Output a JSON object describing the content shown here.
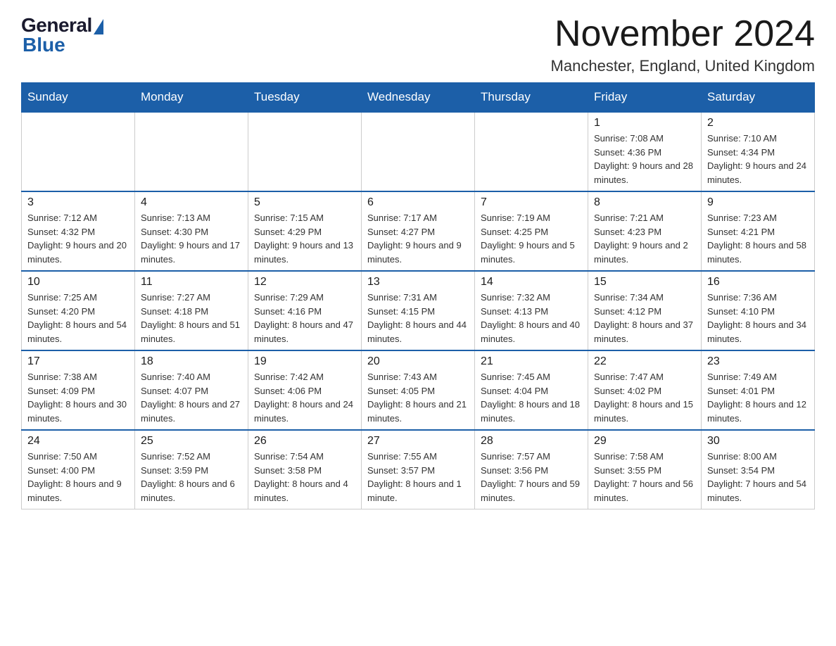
{
  "logo": {
    "text_general": "General",
    "text_blue": "Blue"
  },
  "header": {
    "month_title": "November 2024",
    "location": "Manchester, England, United Kingdom"
  },
  "days_of_week": [
    "Sunday",
    "Monday",
    "Tuesday",
    "Wednesday",
    "Thursday",
    "Friday",
    "Saturday"
  ],
  "weeks": [
    [
      {
        "day": "",
        "info": ""
      },
      {
        "day": "",
        "info": ""
      },
      {
        "day": "",
        "info": ""
      },
      {
        "day": "",
        "info": ""
      },
      {
        "day": "",
        "info": ""
      },
      {
        "day": "1",
        "info": "Sunrise: 7:08 AM\nSunset: 4:36 PM\nDaylight: 9 hours and 28 minutes."
      },
      {
        "day": "2",
        "info": "Sunrise: 7:10 AM\nSunset: 4:34 PM\nDaylight: 9 hours and 24 minutes."
      }
    ],
    [
      {
        "day": "3",
        "info": "Sunrise: 7:12 AM\nSunset: 4:32 PM\nDaylight: 9 hours and 20 minutes."
      },
      {
        "day": "4",
        "info": "Sunrise: 7:13 AM\nSunset: 4:30 PM\nDaylight: 9 hours and 17 minutes."
      },
      {
        "day": "5",
        "info": "Sunrise: 7:15 AM\nSunset: 4:29 PM\nDaylight: 9 hours and 13 minutes."
      },
      {
        "day": "6",
        "info": "Sunrise: 7:17 AM\nSunset: 4:27 PM\nDaylight: 9 hours and 9 minutes."
      },
      {
        "day": "7",
        "info": "Sunrise: 7:19 AM\nSunset: 4:25 PM\nDaylight: 9 hours and 5 minutes."
      },
      {
        "day": "8",
        "info": "Sunrise: 7:21 AM\nSunset: 4:23 PM\nDaylight: 9 hours and 2 minutes."
      },
      {
        "day": "9",
        "info": "Sunrise: 7:23 AM\nSunset: 4:21 PM\nDaylight: 8 hours and 58 minutes."
      }
    ],
    [
      {
        "day": "10",
        "info": "Sunrise: 7:25 AM\nSunset: 4:20 PM\nDaylight: 8 hours and 54 minutes."
      },
      {
        "day": "11",
        "info": "Sunrise: 7:27 AM\nSunset: 4:18 PM\nDaylight: 8 hours and 51 minutes."
      },
      {
        "day": "12",
        "info": "Sunrise: 7:29 AM\nSunset: 4:16 PM\nDaylight: 8 hours and 47 minutes."
      },
      {
        "day": "13",
        "info": "Sunrise: 7:31 AM\nSunset: 4:15 PM\nDaylight: 8 hours and 44 minutes."
      },
      {
        "day": "14",
        "info": "Sunrise: 7:32 AM\nSunset: 4:13 PM\nDaylight: 8 hours and 40 minutes."
      },
      {
        "day": "15",
        "info": "Sunrise: 7:34 AM\nSunset: 4:12 PM\nDaylight: 8 hours and 37 minutes."
      },
      {
        "day": "16",
        "info": "Sunrise: 7:36 AM\nSunset: 4:10 PM\nDaylight: 8 hours and 34 minutes."
      }
    ],
    [
      {
        "day": "17",
        "info": "Sunrise: 7:38 AM\nSunset: 4:09 PM\nDaylight: 8 hours and 30 minutes."
      },
      {
        "day": "18",
        "info": "Sunrise: 7:40 AM\nSunset: 4:07 PM\nDaylight: 8 hours and 27 minutes."
      },
      {
        "day": "19",
        "info": "Sunrise: 7:42 AM\nSunset: 4:06 PM\nDaylight: 8 hours and 24 minutes."
      },
      {
        "day": "20",
        "info": "Sunrise: 7:43 AM\nSunset: 4:05 PM\nDaylight: 8 hours and 21 minutes."
      },
      {
        "day": "21",
        "info": "Sunrise: 7:45 AM\nSunset: 4:04 PM\nDaylight: 8 hours and 18 minutes."
      },
      {
        "day": "22",
        "info": "Sunrise: 7:47 AM\nSunset: 4:02 PM\nDaylight: 8 hours and 15 minutes."
      },
      {
        "day": "23",
        "info": "Sunrise: 7:49 AM\nSunset: 4:01 PM\nDaylight: 8 hours and 12 minutes."
      }
    ],
    [
      {
        "day": "24",
        "info": "Sunrise: 7:50 AM\nSunset: 4:00 PM\nDaylight: 8 hours and 9 minutes."
      },
      {
        "day": "25",
        "info": "Sunrise: 7:52 AM\nSunset: 3:59 PM\nDaylight: 8 hours and 6 minutes."
      },
      {
        "day": "26",
        "info": "Sunrise: 7:54 AM\nSunset: 3:58 PM\nDaylight: 8 hours and 4 minutes."
      },
      {
        "day": "27",
        "info": "Sunrise: 7:55 AM\nSunset: 3:57 PM\nDaylight: 8 hours and 1 minute."
      },
      {
        "day": "28",
        "info": "Sunrise: 7:57 AM\nSunset: 3:56 PM\nDaylight: 7 hours and 59 minutes."
      },
      {
        "day": "29",
        "info": "Sunrise: 7:58 AM\nSunset: 3:55 PM\nDaylight: 7 hours and 56 minutes."
      },
      {
        "day": "30",
        "info": "Sunrise: 8:00 AM\nSunset: 3:54 PM\nDaylight: 7 hours and 54 minutes."
      }
    ]
  ]
}
